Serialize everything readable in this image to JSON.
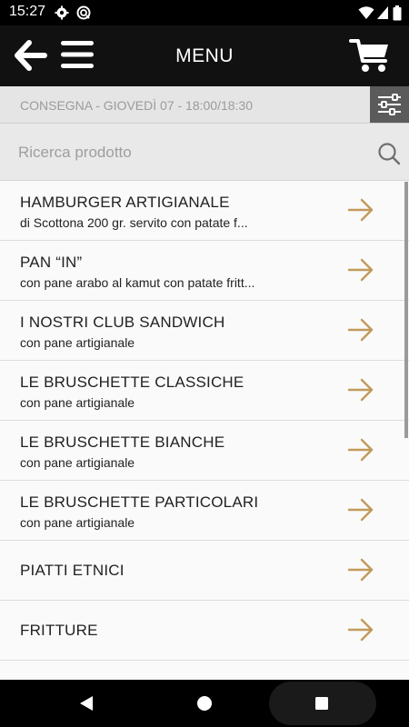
{
  "status_bar": {
    "time": "15:27",
    "icons": [
      "gear-icon",
      "sync-icon",
      "wifi-icon",
      "signal-icon",
      "battery-icon"
    ]
  },
  "header": {
    "title": "MENU",
    "icons": [
      "back-arrow-icon",
      "hamburger-menu-icon",
      "cart-icon"
    ]
  },
  "delivery": {
    "text": "CONSEGNA - GIOVEDÌ 07 - 18:00/18:30",
    "icon": "filter-sliders-icon"
  },
  "search": {
    "placeholder": "Ricerca prodotto",
    "value": "",
    "icon": "search-icon"
  },
  "colors": {
    "accent": "#c19a5b",
    "header_bg": "#111111",
    "filter_bg": "#5b5b5b"
  },
  "menu": {
    "items": [
      {
        "title": "HAMBURGER ARTIGIANALE",
        "subtitle": "di Scottona 200 gr. servito con patate f..."
      },
      {
        "title": "PAN “IN”",
        "subtitle": "con pane arabo al kamut con patate fritt..."
      },
      {
        "title": "I NOSTRI CLUB SANDWICH",
        "subtitle": "con pane artigianale"
      },
      {
        "title": "LE BRUSCHETTE CLASSICHE",
        "subtitle": "con pane artigianale"
      },
      {
        "title": "LE BRUSCHETTE BIANCHE",
        "subtitle": "con pane artigianale"
      },
      {
        "title": "LE BRUSCHETTE PARTICOLARI",
        "subtitle": "con pane artigianale"
      },
      {
        "title": "PIATTI ETNICI",
        "subtitle": ""
      },
      {
        "title": "FRITTURE",
        "subtitle": ""
      }
    ]
  },
  "nav_bar": {
    "icons": [
      "back-triangle-icon",
      "home-circle-icon",
      "recents-square-icon"
    ]
  }
}
